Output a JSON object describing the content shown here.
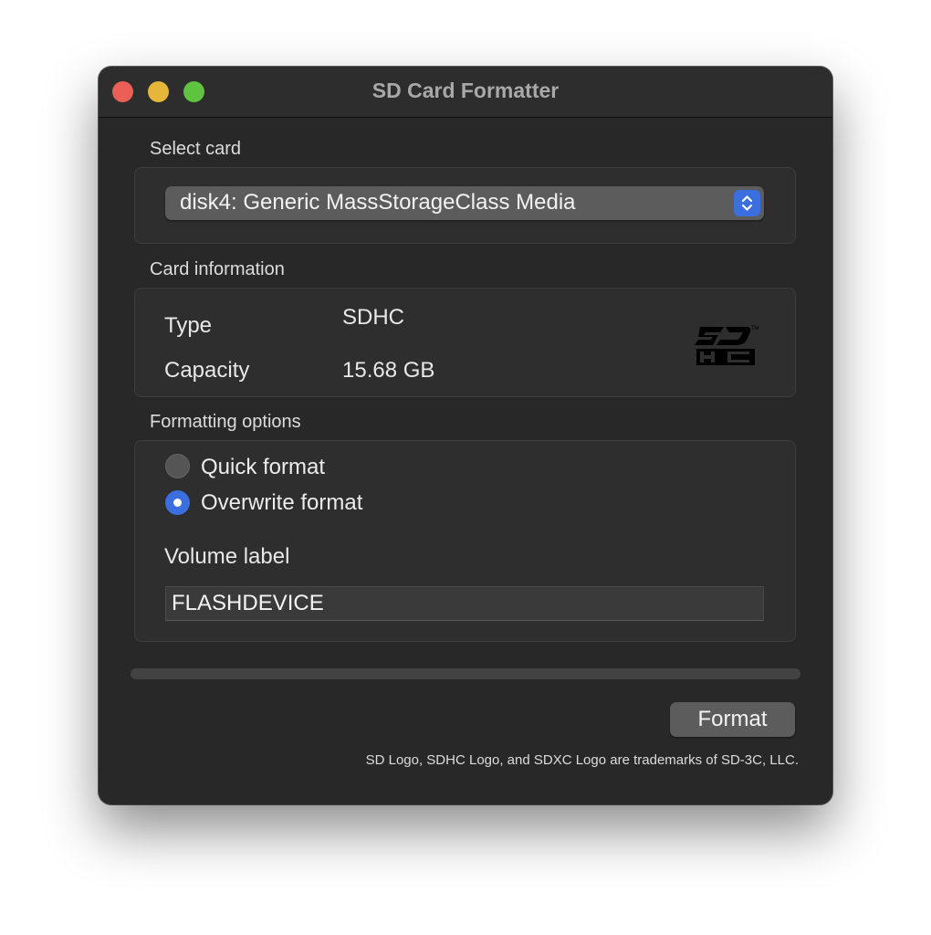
{
  "window": {
    "title": "SD Card Formatter"
  },
  "select_card": {
    "label": "Select card",
    "selected": "disk4: Generic MassStorageClass Media",
    "stepper_icon": "updown-chevron-icon"
  },
  "card_info": {
    "label": "Card information",
    "type_label": "Type",
    "type_value": "SDHC",
    "capacity_label": "Capacity",
    "capacity_value": "15.68 GB",
    "logo_icon": "sdhc-logo"
  },
  "formatting": {
    "label": "Formatting options",
    "options": [
      {
        "label": "Quick format",
        "selected": false
      },
      {
        "label": "Overwrite format",
        "selected": true
      }
    ],
    "volume_label": "Volume label",
    "volume_value": "FLASHDEVICE"
  },
  "progress": {
    "value": 0
  },
  "actions": {
    "format_label": "Format"
  },
  "footer": {
    "trademark": "SD Logo, SDHC Logo, and SDXC Logo are trademarks of SD-3C, LLC."
  },
  "colors": {
    "accent": "#3b6fe0",
    "close": "#ec5f57",
    "minimize": "#e5b63a",
    "zoom": "#5fc340",
    "window_bg": "#282828"
  }
}
